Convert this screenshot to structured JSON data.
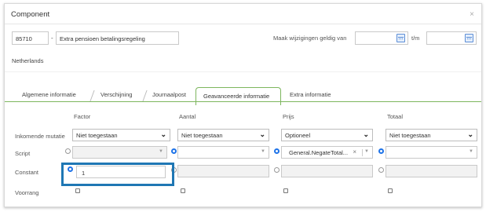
{
  "dialog": {
    "title": "Component",
    "close_icon": "×"
  },
  "header": {
    "code_value": "85710",
    "separator": "-",
    "name_value": "Extra pensioen betalingsregeling",
    "valid_from_label": "Maak wijzigingen geldig van",
    "valid_from_value": "",
    "to_label": "t/m",
    "to_value": ""
  },
  "country": "Netherlands",
  "tabs": [
    "Algemene informatie",
    "Verschijning",
    "Journaalpost",
    "Geavanceerde informatie",
    "Extra informatie"
  ],
  "active_tab": "Geavanceerde informatie",
  "columns": [
    "Factor",
    "Aantal",
    "Prijs",
    "Totaal"
  ],
  "rows": {
    "inkomende": {
      "label": "Inkomende mutatie",
      "values": [
        "Niet toegestaan",
        "Niet toegestaan",
        "Optioneel",
        "Niet toegestaan"
      ]
    },
    "script": {
      "label": "Script",
      "selected_index": [
        false,
        true,
        true,
        true
      ],
      "values": [
        "",
        "",
        "General.NegateTotal...",
        ""
      ]
    },
    "constant": {
      "label": "Constant",
      "selected_index": [
        true,
        false,
        false,
        false
      ],
      "values": [
        "1",
        "",
        "",
        ""
      ]
    },
    "voorrang": {
      "label": "Voorrang"
    }
  },
  "colors": {
    "accent_blue": "#1e73e8",
    "tab_green": "#7db65e",
    "highlight": "#1f77b4"
  }
}
